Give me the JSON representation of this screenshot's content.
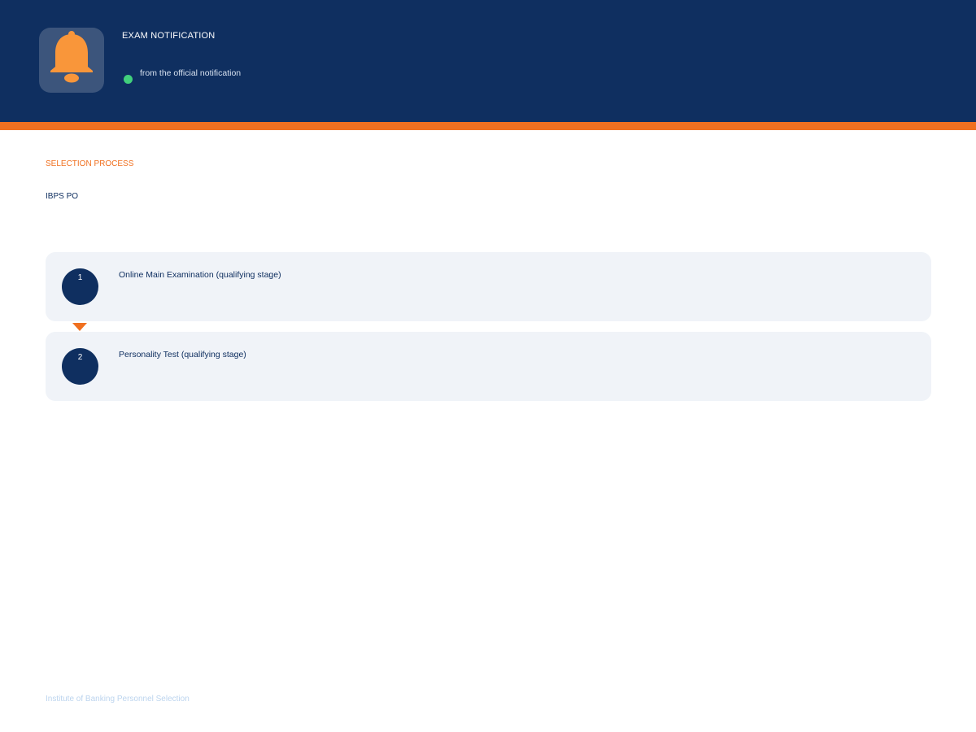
{
  "header": {
    "title": "EXAM NOTIFICATION",
    "subtitle": "from the official notification",
    "icon": "bell-icon",
    "status_color": "#41d07c"
  },
  "section": {
    "label": "SELECTION PROCESS",
    "exam": "IBPS PO"
  },
  "steps": [
    {
      "number": "1",
      "text": "Online Main Examination (qualifying stage)"
    },
    {
      "number": "2",
      "text": "Personality Test (qualifying stage)"
    }
  ],
  "footer": {
    "text": "Institute of Banking Personnel Selection"
  },
  "colors": {
    "primary": "#0f2f60",
    "accent": "#f07020",
    "icon": "#f9963a",
    "card": "#f0f3f8"
  }
}
